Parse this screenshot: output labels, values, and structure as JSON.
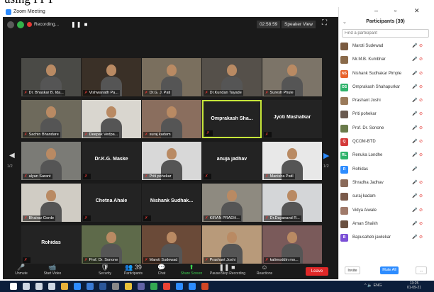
{
  "doc_heading": "using PPT",
  "window": {
    "title": "Zoom Meeting"
  },
  "top_toolbar": {
    "recording_label": "Recording...",
    "pause_stop": "❚❚  ■",
    "timer": "02:58:59",
    "view_label": "Speaker View",
    "fullscreen_icon": "fullscreen-icon"
  },
  "grid": {
    "tiles": [
      {
        "name": "Dr. Bhaskar B. Ida...",
        "type": "video",
        "row": 0,
        "col": 0,
        "bg": "#4a4a46"
      },
      {
        "name": "Vishwanath Pa...",
        "type": "video",
        "row": 0,
        "col": 1,
        "bg": "#3a3027"
      },
      {
        "name": "Dr.G. J. Pati",
        "type": "video",
        "row": 0,
        "col": 2,
        "bg": "#7a6f5e"
      },
      {
        "name": "Dr.Kundan Tayade",
        "type": "video",
        "row": 0,
        "col": 3,
        "bg": "#55504a"
      },
      {
        "name": "Suresh Phule",
        "type": "video",
        "row": 0,
        "col": 4,
        "bg": "#7c7468"
      },
      {
        "name": "Sachin Bhandare",
        "type": "video",
        "row": 1,
        "col": 0,
        "bg": "#6e6a5c"
      },
      {
        "name": "Deepak Vedpa...",
        "type": "video",
        "row": 1,
        "col": 1,
        "bg": "#d9d6cf"
      },
      {
        "name": "suraj kadam",
        "type": "video",
        "row": 1,
        "col": 2,
        "bg": "#8a6e5e"
      },
      {
        "name": "Omprakash Sha...",
        "type": "name",
        "row": 1,
        "col": 3,
        "highlight": true
      },
      {
        "name": "Jyoti Mashalkar",
        "type": "name",
        "row": 1,
        "col": 4
      },
      {
        "name": "alyan Sarant",
        "type": "video",
        "row": 2,
        "col": 0,
        "bg": "#7b7b76"
      },
      {
        "name": "Dr.K.G. Maske",
        "type": "name",
        "row": 2,
        "col": 1
      },
      {
        "name": "Priti pohekar",
        "type": "video",
        "row": 2,
        "col": 2,
        "bg": "#d8d8d8"
      },
      {
        "name": "anuja jadhav",
        "type": "name",
        "row": 2,
        "col": 3
      },
      {
        "name": "Manisha Patil",
        "type": "video",
        "row": 2,
        "col": 4,
        "bg": "#e8e8e8"
      },
      {
        "name": "Bhairav Gorde",
        "type": "video",
        "row": 3,
        "col": 0,
        "bg": "#d0ccc4"
      },
      {
        "name": "Chetna Ahale",
        "type": "name",
        "row": 3,
        "col": 1
      },
      {
        "name": "Nishank Sudhak...",
        "type": "name",
        "row": 3,
        "col": 2
      },
      {
        "name": "KIRAN PRADH...",
        "type": "video",
        "row": 3,
        "col": 3,
        "bg": "#8e8a80"
      },
      {
        "name": "Dr.Dayanand R...",
        "type": "video",
        "row": 3,
        "col": 4,
        "bg": "#d4d6d8"
      },
      {
        "name": "Rohidas",
        "type": "name",
        "row": 4,
        "col": 0
      },
      {
        "name": "Prof. Dr. Sonone",
        "type": "video",
        "row": 4,
        "col": 1,
        "bg": "#5e6a4a"
      },
      {
        "name": "Maroti Sudewad",
        "type": "video",
        "row": 4,
        "col": 2,
        "bg": "#6a4a38"
      },
      {
        "name": "Prashant Joshi",
        "type": "video",
        "row": 4,
        "col": 3,
        "bg": "#b89a7a"
      },
      {
        "name": "kalimoddin mo...",
        "type": "video",
        "row": 4,
        "col": 4,
        "bg": "#7a5a5a"
      }
    ],
    "page_left": "1/2",
    "page_right": "1/2"
  },
  "bottom_toolbar": {
    "buttons": [
      {
        "label": "Unmute",
        "icon": "🎤",
        "name": "unmute-button"
      },
      {
        "label": "Start Video",
        "icon": "📹",
        "name": "start-video-button"
      },
      {
        "label": "Security",
        "icon": "🛡",
        "name": "security-button"
      },
      {
        "label": "Participants",
        "icon": "👥 39",
        "name": "participants-button"
      },
      {
        "label": "Chat",
        "icon": "💬",
        "name": "chat-button"
      },
      {
        "label": "Share Screen",
        "icon": "⬆",
        "name": "share-screen-button"
      },
      {
        "label": "Pause/Stop Recording",
        "icon": "❚❚ ■",
        "name": "pause-stop-recording-button"
      },
      {
        "label": "Reactions",
        "icon": "☺",
        "name": "reactions-button"
      }
    ],
    "leave": "Leave"
  },
  "panel": {
    "title": "Participants (39)",
    "search_placeholder": "Find a participant",
    "participants": [
      {
        "name": "Maroti Sudewad",
        "avatar": "",
        "color": "#7a5a40",
        "cam": true
      },
      {
        "name": "Mr.M.B. Kumbhar",
        "avatar": "",
        "color": "#8a6a4a",
        "cam": true
      },
      {
        "name": "Nishank Sudhakar Pimple",
        "avatar": "NS",
        "color": "#e8632b",
        "cam": true
      },
      {
        "name": "Omprakash Shahapurkar",
        "avatar": "OS",
        "color": "#2fb36a",
        "cam": true
      },
      {
        "name": "Prashant Joshi",
        "avatar": "",
        "color": "#9a7a5a",
        "cam": true
      },
      {
        "name": "Priti pohekar",
        "avatar": "",
        "color": "#6a5a50",
        "cam": true
      },
      {
        "name": "Prof. Dr. Sonone",
        "avatar": "",
        "color": "#6a7a4a",
        "cam": true
      },
      {
        "name": "QCOM-BTD",
        "avatar": "Q",
        "color": "#d43a3a",
        "cam": true
      },
      {
        "name": "Renuka Londhe",
        "avatar": "RL",
        "color": "#2fb36a",
        "cam": true
      },
      {
        "name": "Rohidas",
        "avatar": "R",
        "color": "#2d8cff",
        "cam": false
      },
      {
        "name": "Shradha Jadhav",
        "avatar": "",
        "color": "#8a6a5a",
        "cam": true
      },
      {
        "name": "suraj kadam",
        "avatar": "",
        "color": "#7a5a4a",
        "cam": true
      },
      {
        "name": "Vidya Aiwale",
        "avatar": "",
        "color": "#a07a6a",
        "cam": true
      },
      {
        "name": "Aman Shaikh",
        "avatar": "",
        "color": "#6a5040",
        "cam": true
      },
      {
        "name": "Bapusaheb jawlekar",
        "avatar": "B",
        "color": "#7b4fd6",
        "cam": true
      }
    ],
    "invite": "Invite",
    "mute_all": "Mute All",
    "more": "..."
  },
  "taskbar": {
    "tray_text": "^ 🔈 ENG",
    "time": "13:25",
    "date": "01-09-21"
  }
}
